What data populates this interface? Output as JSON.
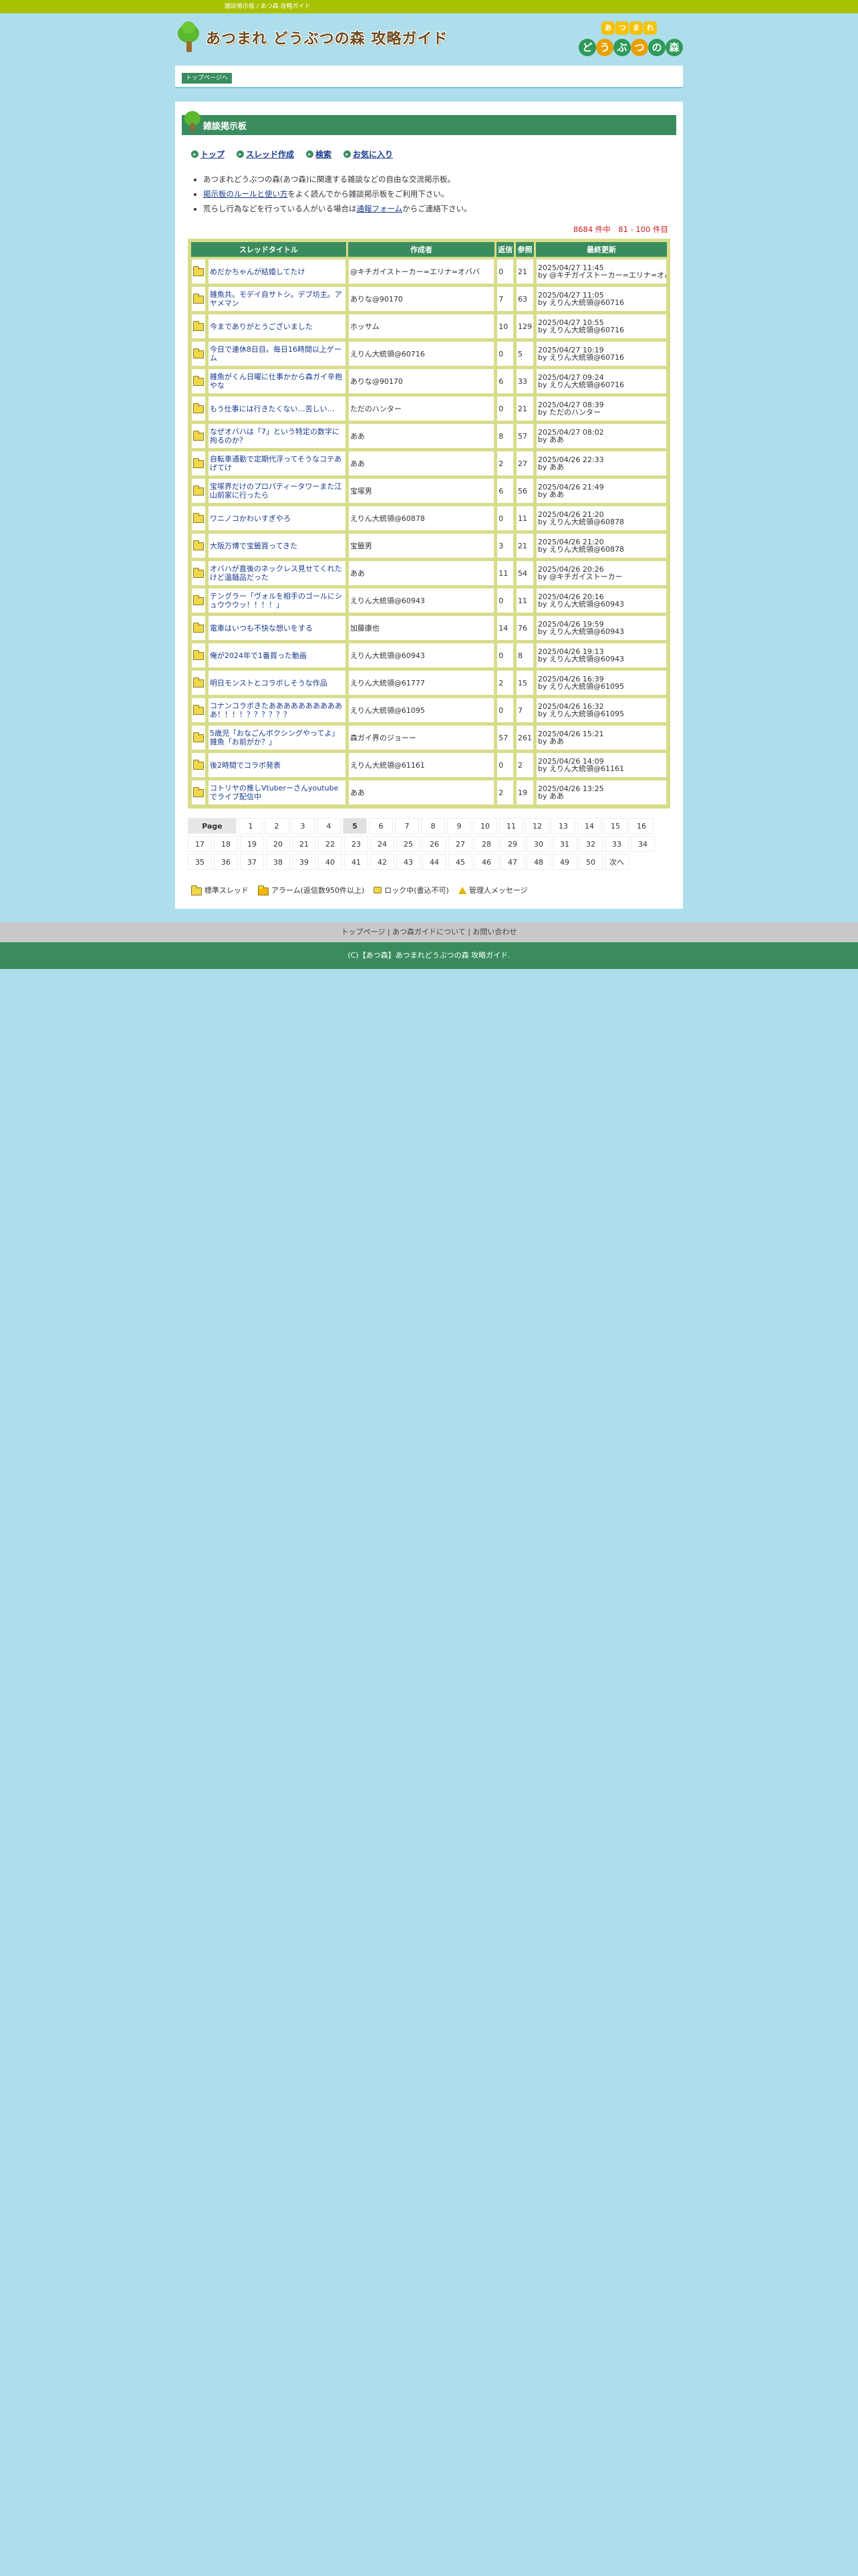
{
  "topbar": {
    "text": "雑談掲示板 / あつ森 攻略ガイド"
  },
  "header": {
    "site_title": "あつまれ どうぶつの森 攻略ガイド",
    "badge_small": [
      "あ",
      "つ",
      "ま",
      "れ"
    ],
    "badge_large": [
      "ど",
      "う",
      "ぶ",
      "つ",
      "の",
      "森"
    ]
  },
  "breadcrumb": {
    "top_label": "トップページへ"
  },
  "bbs": {
    "title": "雑談掲示板",
    "nav": [
      {
        "label": "トップ"
      },
      {
        "label": "スレッド作成"
      },
      {
        "label": "検索"
      },
      {
        "label": "お気に入り"
      }
    ],
    "notes": {
      "line1": "あつまれどうぶつの森(あつ森)に関連する雑談などの自由な交流掲示板。",
      "line2_link": "掲示板のルールと使い方",
      "line2_rest": "をよく読んでから雑談掲示板をご利用下さい。",
      "line3_pre": "荒らし行為などを行っている人がいる場合は",
      "line3_link": "通報フォーム",
      "line3_post": "からご連絡下さい。"
    },
    "count": "8684 件中　81 - 100 件目"
  },
  "table": {
    "headers": {
      "title": "スレッドタイトル",
      "author": "作成者",
      "replies": "返信",
      "views": "参照",
      "updated": "最終更新"
    },
    "rows": [
      {
        "title": "めだかちゃんが結婚してたけ",
        "author": "@キチガイストーカー=エリナ=オババ",
        "replies": "0",
        "views": "21",
        "date": "2025/04/27 11:45",
        "by": "by @キチガイストーカー=エリナ=オババ"
      },
      {
        "title": "雑魚共。モデイ自サトシ。デブ坊主。アヤメマン",
        "author": "ありな@90170",
        "replies": "7",
        "views": "63",
        "date": "2025/04/27 11:05",
        "by": "by えりん大統領@60716"
      },
      {
        "title": "今までありがとうございました",
        "author": "ホッサム",
        "replies": "10",
        "views": "129",
        "date": "2025/04/27 10:55",
        "by": "by えりん大統領@60716"
      },
      {
        "title": "今日で連休8日目。毎日16時間以上ゲーム",
        "author": "えりん大統領@60716",
        "replies": "0",
        "views": "5",
        "date": "2025/04/27 10:19",
        "by": "by えりん大統領@60716"
      },
      {
        "title": "雑魚がくん日曜に仕事かから森ガイ辛抱やな",
        "author": "ありな@90170",
        "replies": "6",
        "views": "33",
        "date": "2025/04/27 09:24",
        "by": "by えりん大統領@60716"
      },
      {
        "title": "もう仕事には行きたくない…苦しい…",
        "author": "ただのハンター",
        "replies": "0",
        "views": "21",
        "date": "2025/04/27 08:39",
        "by": "by ただのハンター"
      },
      {
        "title": "なぜオバハは「7」という特定の数字に拘るのか？",
        "author": "ああ",
        "replies": "8",
        "views": "57",
        "date": "2025/04/27 08:02",
        "by": "by ああ"
      },
      {
        "title": "自転車通勤で定期代浮ってそうなコテあげてけ",
        "author": "ああ",
        "replies": "2",
        "views": "27",
        "date": "2025/04/26 22:33",
        "by": "by ああ"
      },
      {
        "title": "宝塚界だけのプロパティータワーまた江山前家に行ったら",
        "author": "宝塚男",
        "replies": "6",
        "views": "56",
        "date": "2025/04/26 21:49",
        "by": "by ああ"
      },
      {
        "title": "ワニノコかわいすぎやろ",
        "author": "えりん大統領@60878",
        "replies": "0",
        "views": "11",
        "date": "2025/04/26 21:20",
        "by": "by えりん大統領@60878"
      },
      {
        "title": "大阪万博で宝籤買ってきた",
        "author": "宝籤男",
        "replies": "3",
        "views": "21",
        "date": "2025/04/26 21:20",
        "by": "by えりん大統領@60878"
      },
      {
        "title": "オバハが直後のネックレス見せてくれたけど温麺品だった",
        "author": "ああ",
        "replies": "11",
        "views": "54",
        "date": "2025/04/26 20:26",
        "by": "by @キチガイストーカー"
      },
      {
        "title": "テングラー「ヴォルを相手のゴールにシュウウウッ！！！！」",
        "author": "えりん大統領@60943",
        "replies": "0",
        "views": "11",
        "date": "2025/04/26 20:16",
        "by": "by えりん大統領@60943"
      },
      {
        "title": "電車はいつも不快な想いをする",
        "author": "加藤康也",
        "replies": "14",
        "views": "76",
        "date": "2025/04/26 19:59",
        "by": "by えりん大統領@60943"
      },
      {
        "title": "俺が2024年で1番買った動画",
        "author": "えりん大統領@60943",
        "replies": "0",
        "views": "8",
        "date": "2025/04/26 19:13",
        "by": "by えりん大統領@60943"
      },
      {
        "title": "明日モンストとコラボしそうな作品",
        "author": "えりん大統領@61777",
        "replies": "2",
        "views": "15",
        "date": "2025/04/26 16:39",
        "by": "by えりん大統領@61095"
      },
      {
        "title": "コナンコラボきたあああああああああああ！！！！？？？？？？",
        "author": "えりん大統領@61095",
        "replies": "0",
        "views": "7",
        "date": "2025/04/26 16:32",
        "by": "by えりん大統領@61095"
      },
      {
        "title": "5歳児「おなごんボクシングやってよ」雑魚「お前がか？」",
        "author": "森ガイ界のジョーー",
        "replies": "57",
        "views": "261",
        "date": "2025/04/26 15:21",
        "by": "by ああ"
      },
      {
        "title": "後2時間でコラボ発表",
        "author": "えりん大統領@61161",
        "replies": "0",
        "views": "2",
        "date": "2025/04/26 14:09",
        "by": "by えりん大統領@61161"
      },
      {
        "title": "コトリヤの推しVtuberーさんyoutubeでライブ配信中",
        "author": "ああ",
        "replies": "2",
        "views": "19",
        "date": "2025/04/26 13:25",
        "by": "by ああ"
      }
    ]
  },
  "pager": {
    "label": "Page",
    "current": "5",
    "row1": [
      "1",
      "2",
      "3",
      "4",
      "5",
      "6",
      "7",
      "8",
      "9",
      "10",
      "11",
      "12",
      "13",
      "14",
      "15",
      "16"
    ],
    "row2": [
      "17",
      "18",
      "19",
      "20",
      "21",
      "22",
      "23",
      "24",
      "25",
      "26",
      "27",
      "28",
      "29",
      "30",
      "31",
      "32",
      "33",
      "34"
    ],
    "row3": [
      "35",
      "36",
      "37",
      "38",
      "39",
      "40",
      "41",
      "42",
      "43",
      "44",
      "45",
      "46",
      "47",
      "48",
      "49",
      "50",
      "次へ"
    ]
  },
  "legend": {
    "standard": "標準スレッド",
    "alarm": "アラーム(返信数950件以上)",
    "locked": "ロック中(書込不可)",
    "admin": "管理人メッセージ"
  },
  "footer": {
    "links": "トップページ | あつ森ガイドについて | お問い合わせ",
    "copyright": "(C)【あつ森】あつまれどうぶつの森 攻略ガイド."
  },
  "colors": {
    "green": "#3a8c5e",
    "lime": "#a9c200",
    "sky": "#aedeeb",
    "red": "#cc2222"
  }
}
